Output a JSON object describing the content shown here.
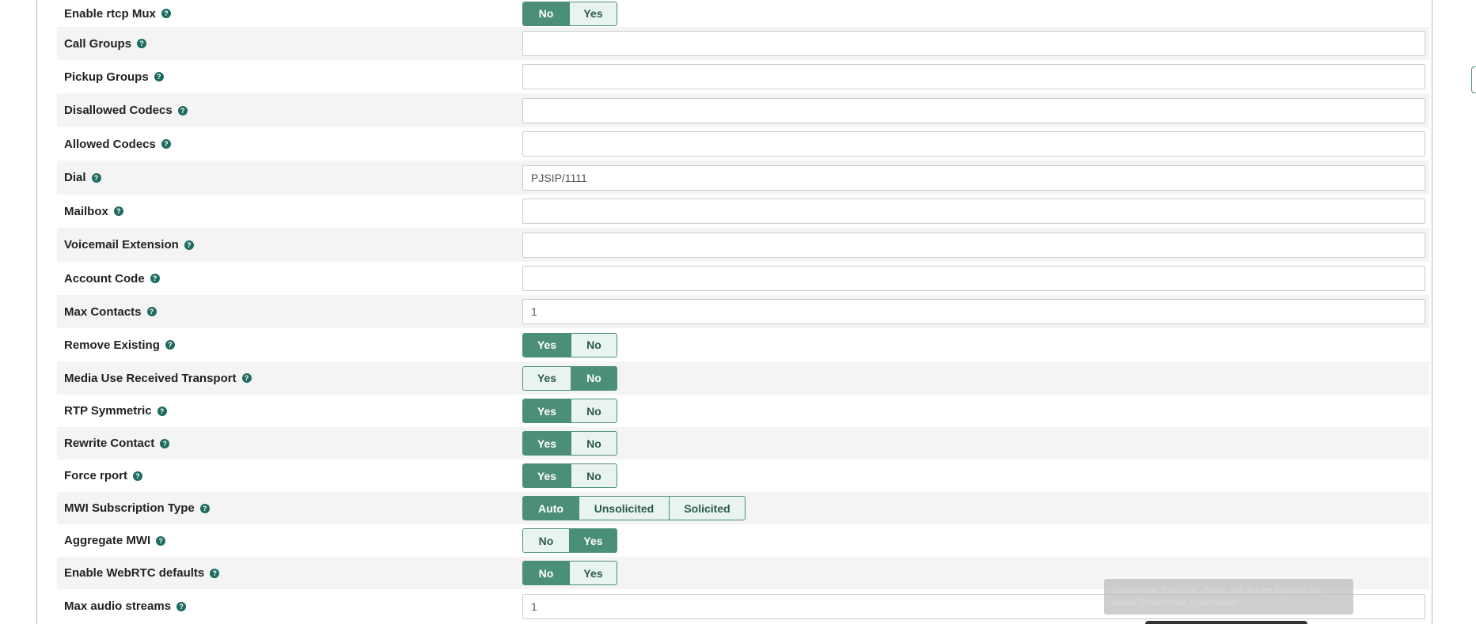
{
  "help_glyph": "?",
  "rows": [
    {
      "label": "Enable rtcp Mux",
      "type": "toggle",
      "options": [
        "No",
        "Yes"
      ],
      "active": 0
    },
    {
      "label": "Call Groups",
      "type": "input",
      "value": ""
    },
    {
      "label": "Pickup Groups",
      "type": "input",
      "value": ""
    },
    {
      "label": "Disallowed Codecs",
      "type": "input",
      "value": ""
    },
    {
      "label": "Allowed Codecs",
      "type": "input",
      "value": ""
    },
    {
      "label": "Dial",
      "type": "input",
      "value": "PJSIP/1111"
    },
    {
      "label": "Mailbox",
      "type": "input",
      "value": ""
    },
    {
      "label": "Voicemail Extension",
      "type": "input",
      "value": ""
    },
    {
      "label": "Account Code",
      "type": "input",
      "value": ""
    },
    {
      "label": "Max Contacts",
      "type": "input",
      "value": "1"
    },
    {
      "label": "Remove Existing",
      "type": "toggle",
      "options": [
        "Yes",
        "No"
      ],
      "active": 0
    },
    {
      "label": "Media Use Received Transport",
      "type": "toggle",
      "options": [
        "Yes",
        "No"
      ],
      "active": 1
    },
    {
      "label": "RTP Symmetric",
      "type": "toggle",
      "options": [
        "Yes",
        "No"
      ],
      "active": 0
    },
    {
      "label": "Rewrite Contact",
      "type": "toggle",
      "options": [
        "Yes",
        "No"
      ],
      "active": 0
    },
    {
      "label": "Force rport",
      "type": "toggle",
      "options": [
        "Yes",
        "No"
      ],
      "active": 0
    },
    {
      "label": "MWI Subscription Type",
      "type": "toggle",
      "options": [
        "Auto",
        "Unsolicited",
        "Solicited"
      ],
      "active": 0
    },
    {
      "label": "Aggregate MWI",
      "type": "toggle",
      "options": [
        "No",
        "Yes"
      ],
      "active": 1
    },
    {
      "label": "Enable WebRTC defaults",
      "type": "toggle",
      "options": [
        "No",
        "Yes"
      ],
      "active": 0
    },
    {
      "label": "Max audio streams",
      "type": "input",
      "value": "1"
    }
  ],
  "toast": {
    "text": "Drücke die \"DRUCK\"-Taste auf deiner Tastatur um einen Screenshot zu erstellen"
  },
  "colors": {
    "accent": "#4b8f76",
    "accent_light": "#e9f3ef",
    "row_alt": "#f4f4f4",
    "help_icon": "#1e6b60"
  }
}
